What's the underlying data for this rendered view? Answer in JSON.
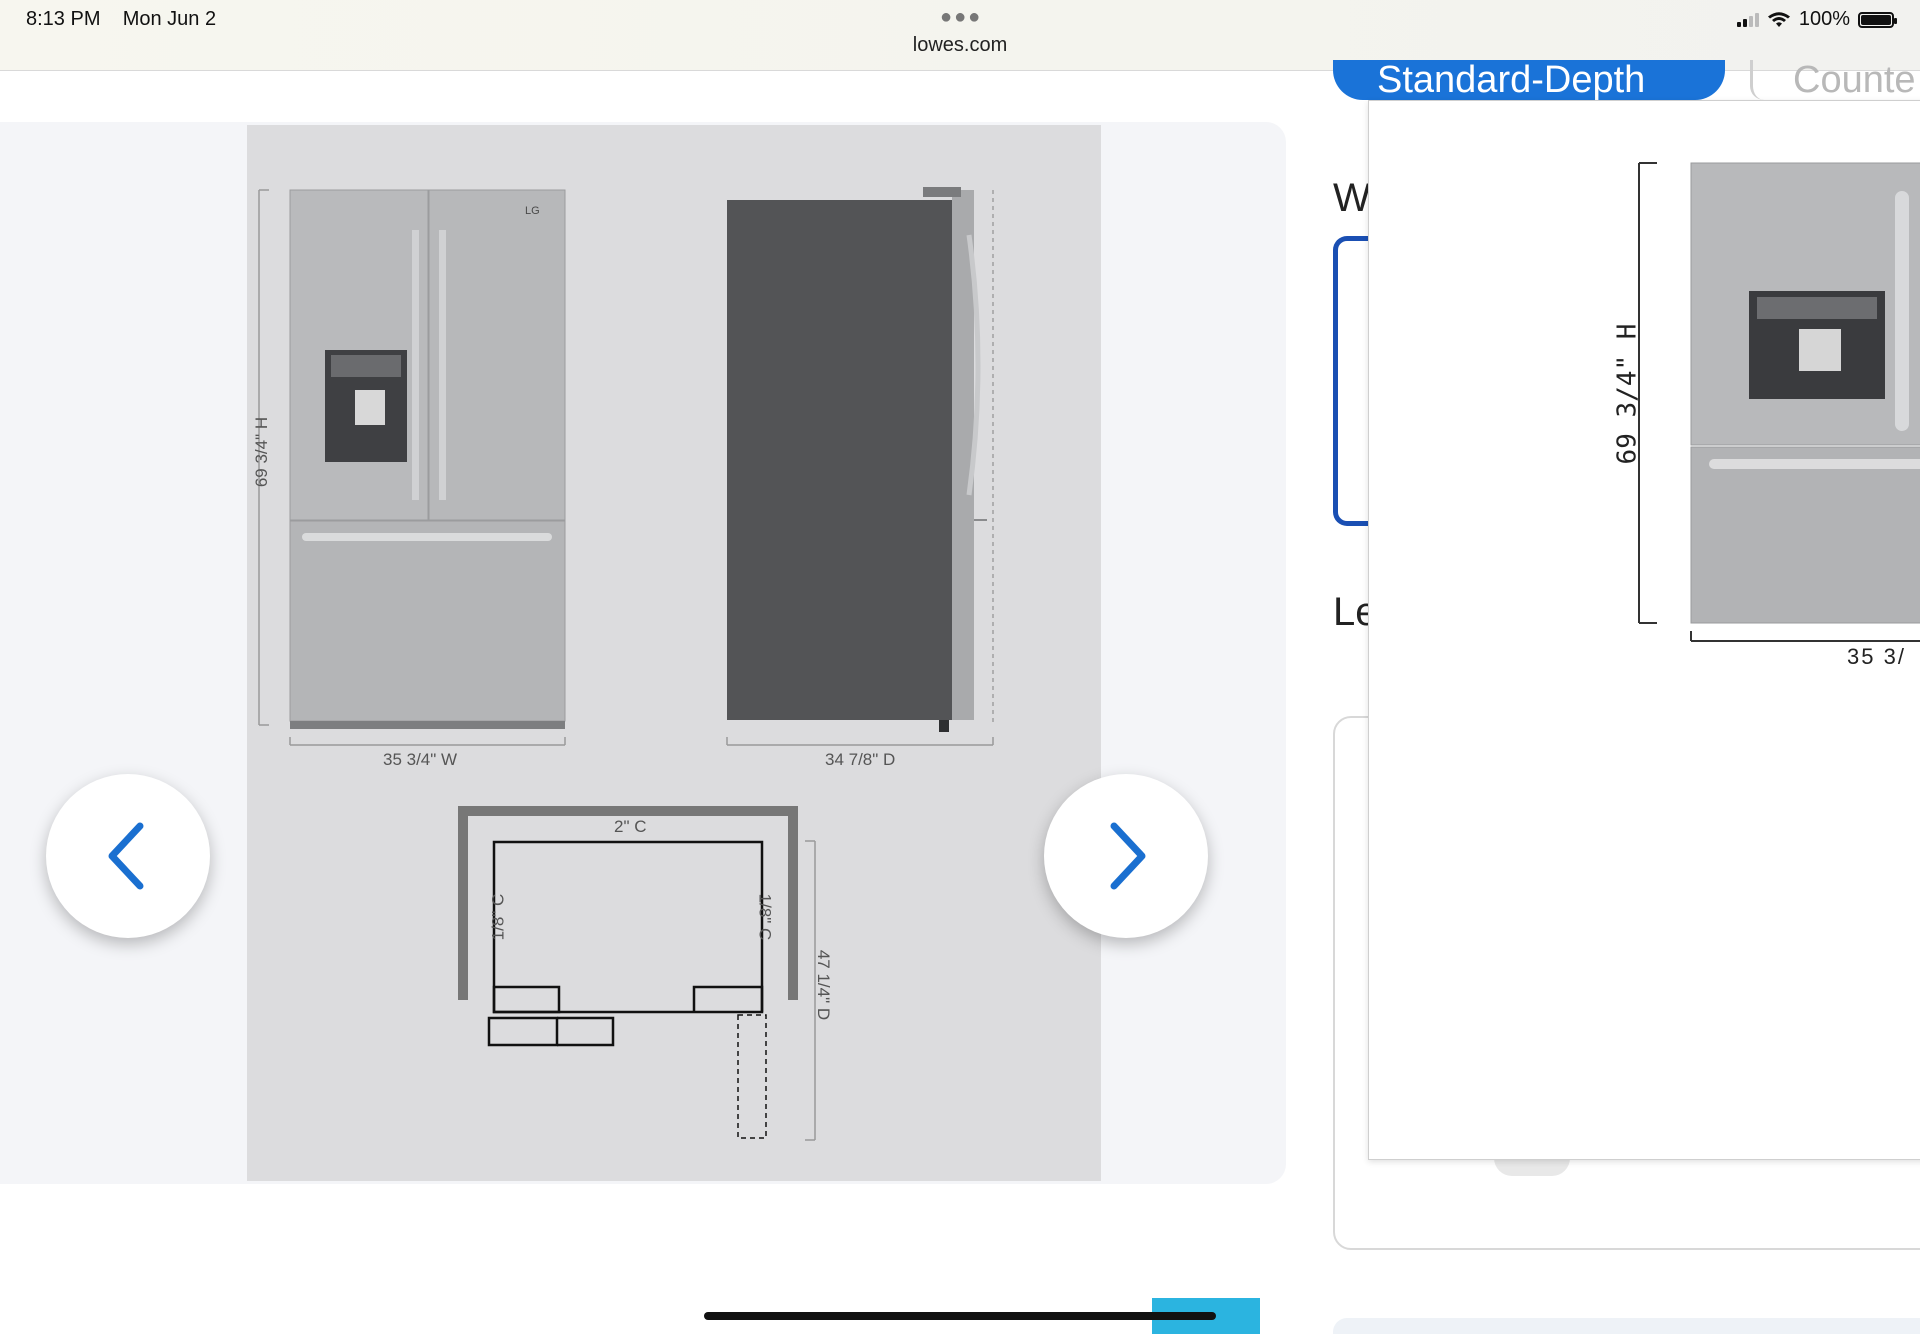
{
  "status_bar": {
    "time": "8:13 PM",
    "date": "Mon Jun 2",
    "url": "lowes.com",
    "battery": "100%"
  },
  "gallery": {
    "image_alt": "LG French door refrigerator dimensions",
    "dimensions": {
      "height": "69 3/4\" H",
      "width": "35 3/4\" W",
      "depth": "34 7/8\" D",
      "top_clearance": "2\" C",
      "side_clearance_left": "1/8\" C",
      "side_clearance_right": "1/8\" C",
      "door_open_depth": "47 1/4\" D"
    },
    "logo": "LG"
  },
  "depth_tabs": {
    "standard": "Standard-Depth",
    "counter": "Counte"
  },
  "right_fragments": {
    "w": "W",
    "le": "Le"
  },
  "popup": {
    "height": "69 3/4\" H",
    "width": "35 3/"
  },
  "colors": {
    "accent": "#1a73d8",
    "card_border": "#1a4fb3",
    "nav_arrow": "#1a6fd0"
  }
}
